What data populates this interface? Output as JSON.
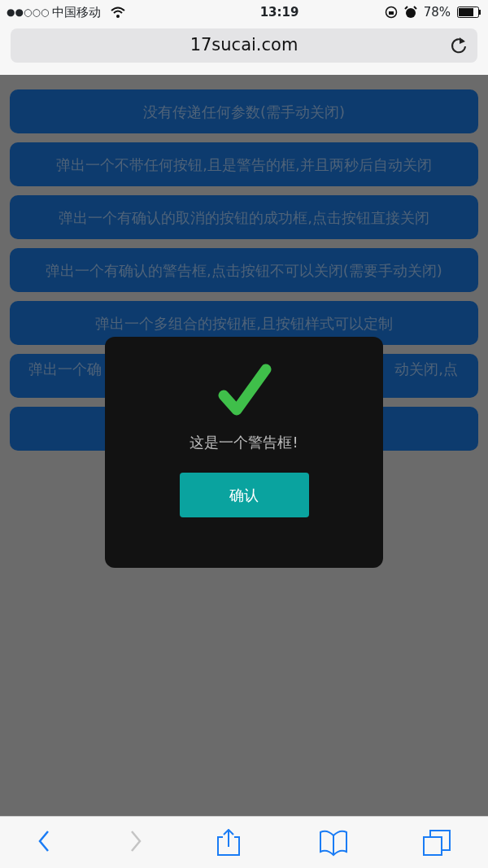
{
  "status_bar": {
    "signal": "●●○○○",
    "carrier": "中国移动",
    "time": "13:19",
    "battery": "78%"
  },
  "address_bar": {
    "url": "17sucai.com"
  },
  "demo_buttons": [
    {
      "kind": "full",
      "text": "没有传递任何参数(需手动关闭)"
    },
    {
      "kind": "full",
      "text": "弹出一个不带任何按钮,且是警告的框,并且两秒后自动关闭"
    },
    {
      "kind": "full",
      "text": "弹出一个有确认的取消的按钮的成功框,点击按钮直接关闭"
    },
    {
      "kind": "full",
      "text": "弹出一个有确认的警告框,点击按钮不可以关闭(需要手动关闭)"
    },
    {
      "kind": "full",
      "text": "弹出一个多组合的按钮框,且按钮样式可以定制"
    },
    {
      "kind": "covered",
      "visible_left": "弹出一个确",
      "visible_right": "动关闭,点"
    },
    {
      "kind": "covered"
    }
  ],
  "dialog": {
    "message": "这是一个警告框!",
    "confirm": "确认"
  },
  "toolbar": [
    {
      "kind": "back",
      "disabled": false
    },
    {
      "kind": "forward",
      "disabled": true
    },
    {
      "kind": "share",
      "disabled": false
    },
    {
      "kind": "bookmarks",
      "disabled": false
    },
    {
      "kind": "tabs",
      "disabled": false
    }
  ]
}
